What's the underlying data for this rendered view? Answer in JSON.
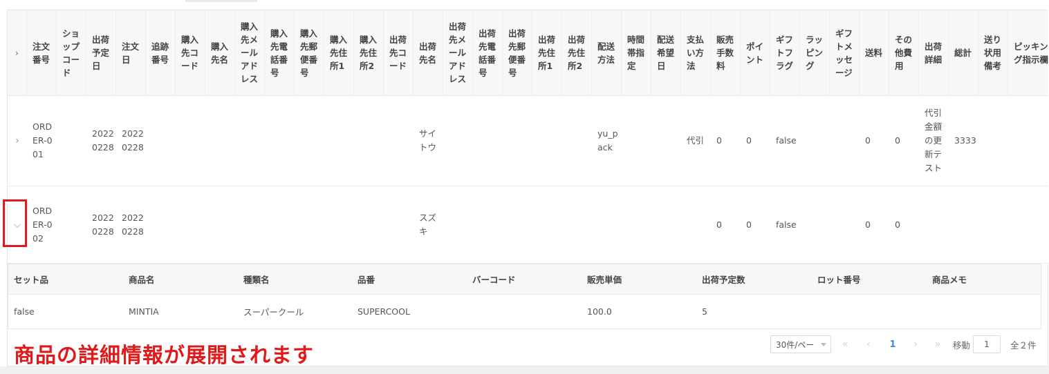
{
  "table": {
    "headers": [
      "注文番号",
      "ショップコード",
      "出荷予定日",
      "注文日",
      "追跡番号",
      "購入先コード",
      "購入先名",
      "購入先メールアドレス",
      "購入先電話番号",
      "購入先郵便番号",
      "購入先住所1",
      "購入先住所2",
      "出荷先コード",
      "出荷先名",
      "出荷先メールアドレス",
      "出荷先電話番号",
      "出荷先郵便番号",
      "出荷先住所1",
      "出荷先住所2",
      "配送方法",
      "時間帯指定",
      "配送希望日",
      "支払い方法",
      "販売手数料",
      "ポイント",
      "ギフトフラグ",
      "ラッピング",
      "ギフトメッセージ",
      "送料",
      "その他費用",
      "出荷詳細",
      "総計",
      "送り状用備考",
      "ピッキング指示欄"
    ],
    "expand_header_icon": "chevron-right-icon",
    "rows": [
      {
        "expand_icon": "chevron-right-icon",
        "order_no": "ORDER-001",
        "ship_date": "20220228",
        "order_date": "20220228",
        "ship_name": "サイトウ",
        "delivery": "yu_pack",
        "payment": "代引",
        "fee": "0",
        "point": "0",
        "gift_flag": "false",
        "shipping": "0",
        "other": "0",
        "detail": "代引金額の更新テスト",
        "total": "3333"
      },
      {
        "expand_icon": "chevron-down-icon",
        "order_no": "ORDER-002",
        "ship_date": "20220228",
        "order_date": "20220228",
        "ship_name": "スズキ",
        "delivery": "",
        "payment": "",
        "fee": "0",
        "point": "0",
        "gift_flag": "false",
        "shipping": "0",
        "other": "0",
        "detail": "",
        "total": ""
      }
    ]
  },
  "subtable": {
    "headers": [
      "セット品",
      "商品名",
      "種類名",
      "品番",
      "バーコード",
      "販売単価",
      "出荷予定数",
      "ロット番号",
      "商品メモ"
    ],
    "row": [
      "false",
      "MINTIA",
      "スーパークール",
      "SUPERCOOL",
      "",
      "100.0",
      "5",
      "",
      ""
    ]
  },
  "annotation": "商品の詳細情報が展開されます",
  "pagination": {
    "page_size": "30件/ペー",
    "first_icon": "double-chevron-left-icon",
    "prev_icon": "chevron-left-icon",
    "current_page": "1",
    "next_icon": "chevron-right-icon",
    "last_icon": "double-chevron-right-icon",
    "jump_label": "移動",
    "jump_value": "1",
    "total": "全２件"
  },
  "colors": {
    "accent": "#3c8dde",
    "highlight": "#e0191b"
  }
}
